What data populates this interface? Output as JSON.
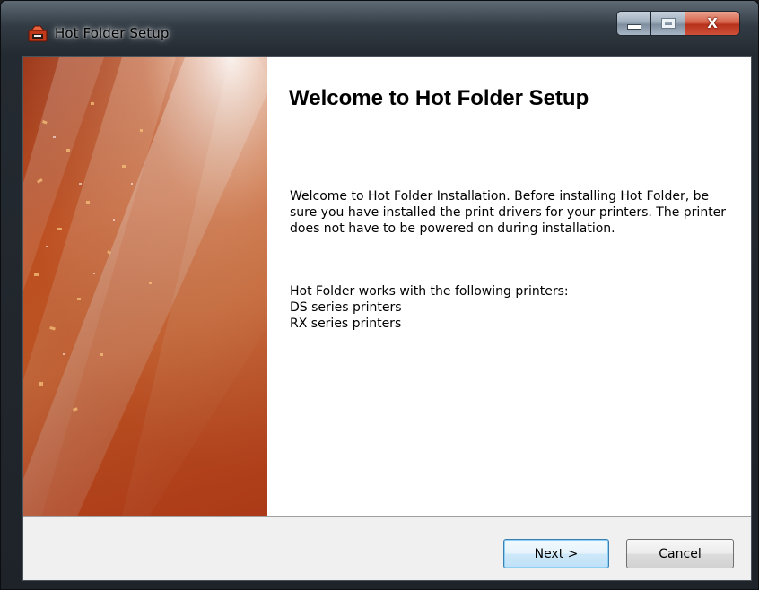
{
  "window": {
    "title": "Hot Folder Setup",
    "icon": "hot-folder-app-icon",
    "caption_buttons": {
      "minimize_icon": "minimize-icon",
      "maximize_icon": "maximize-icon",
      "close_glyph": "X"
    }
  },
  "wizard": {
    "title": "Welcome to Hot Folder Setup",
    "intro": "Welcome to Hot Folder Installation. Before installing Hot Folder, be sure you have installed the print drivers for your printers. The printer does not have to be powered on during installation.",
    "printers_heading": "Hot Folder works with the following printers:",
    "printers": [
      "DS series printers",
      "RX series printers"
    ]
  },
  "buttons": {
    "next_label": "Next >",
    "cancel_label": "Cancel"
  },
  "colors": {
    "banner_orange": "#e1692d",
    "banner_dark": "#9a3518",
    "default_button_border": "#3c7fb1",
    "close_button_red": "#c8452c"
  }
}
